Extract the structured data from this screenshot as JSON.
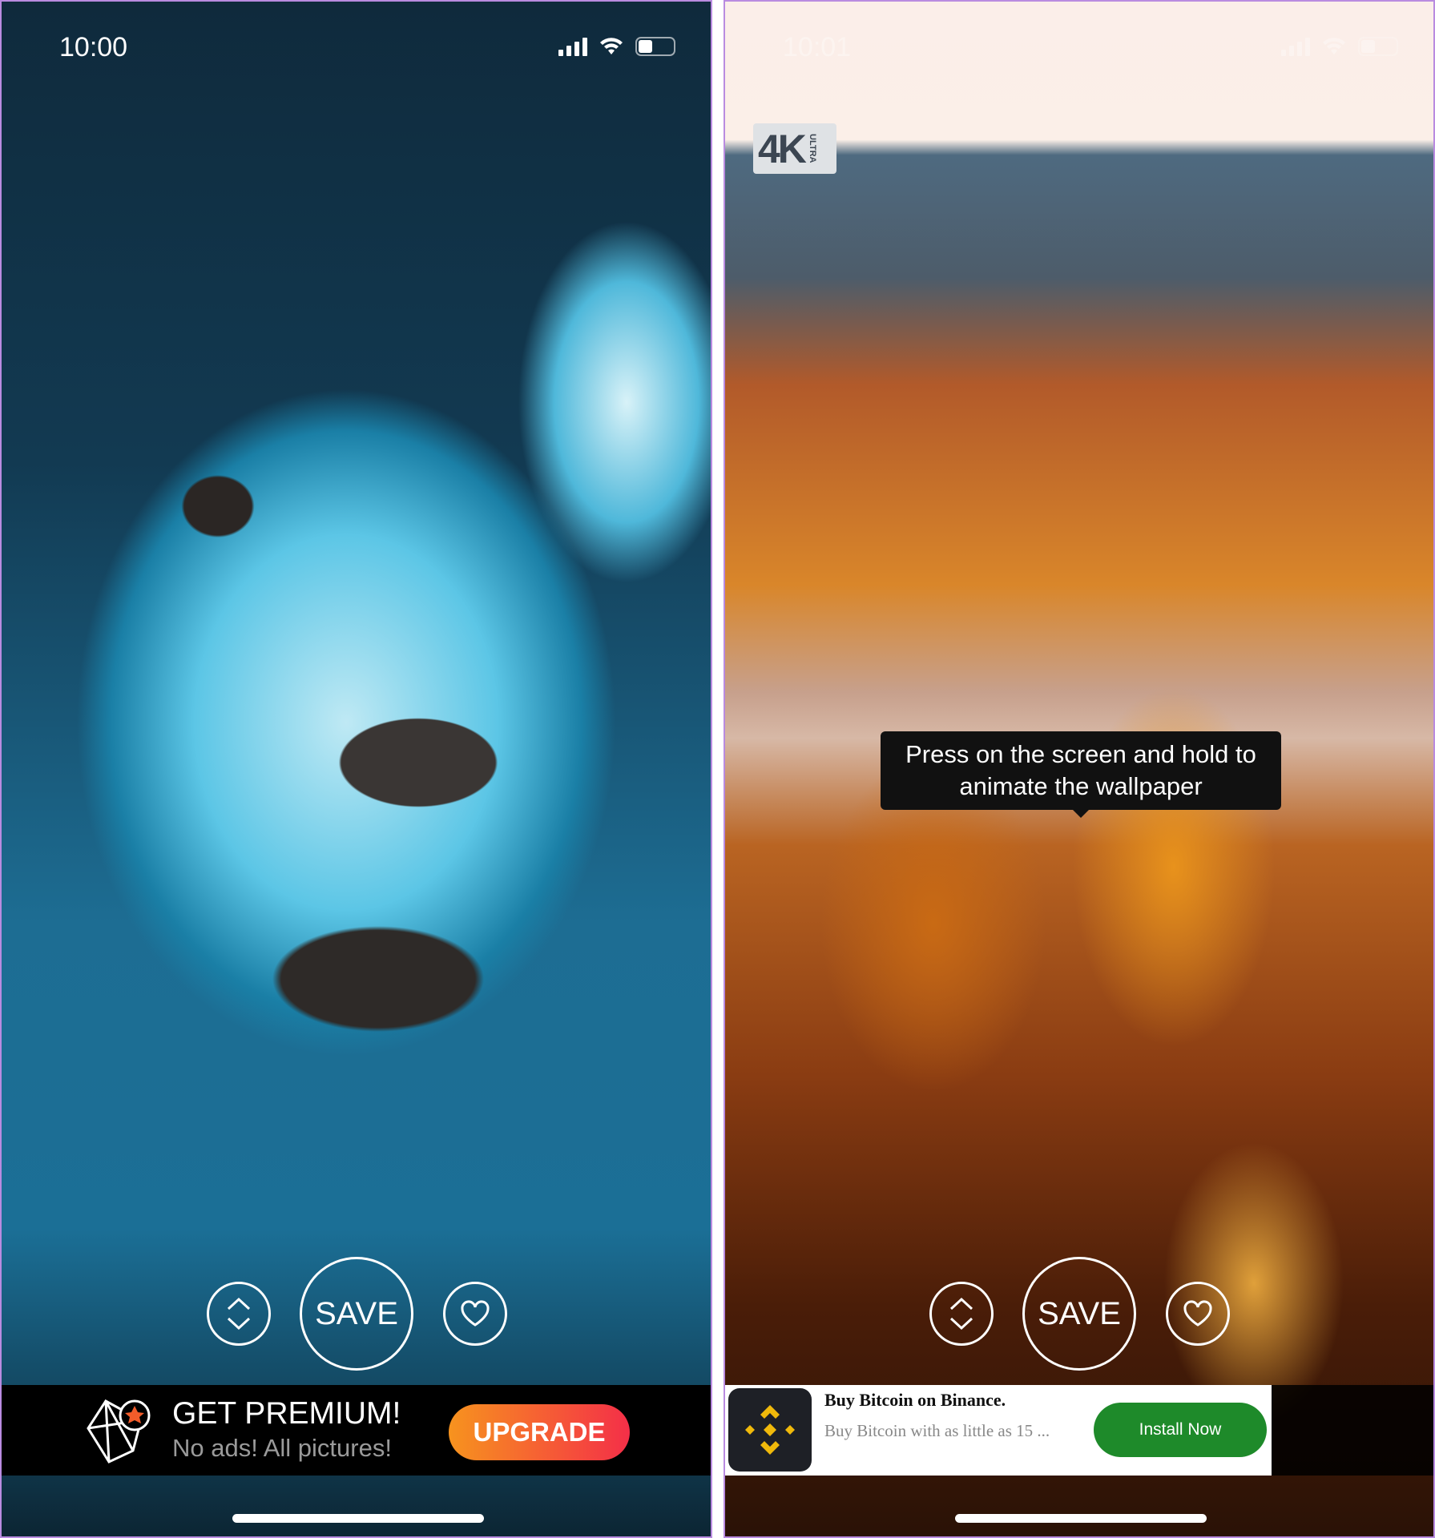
{
  "left_screen": {
    "status_bar": {
      "time": "10:00"
    },
    "controls": {
      "sort_icon": "up-down-chevron-icon",
      "save_label": "SAVE",
      "favorite_icon": "heart-icon"
    },
    "premium_banner": {
      "title": "GET PREMIUM!",
      "subtitle": "No ads! All pictures!",
      "button_label": "UPGRADE",
      "button_gradient": [
        "#f7931e",
        "#f42f48"
      ]
    }
  },
  "right_screen": {
    "status_bar": {
      "time": "10:01"
    },
    "badge": {
      "main": "4K",
      "sub": "ULTRA"
    },
    "tooltip": "Press on the screen and hold to animate the wallpaper",
    "controls": {
      "sort_icon": "up-down-chevron-icon",
      "save_label": "SAVE",
      "favorite_icon": "heart-icon"
    },
    "ad": {
      "title": "Buy Bitcoin on Binance.",
      "description": "Buy Bitcoin with as little as 15 ...",
      "button_label": "Install Now",
      "button_color": "#1e8a2a",
      "logo_color": "#f0b90b"
    }
  }
}
